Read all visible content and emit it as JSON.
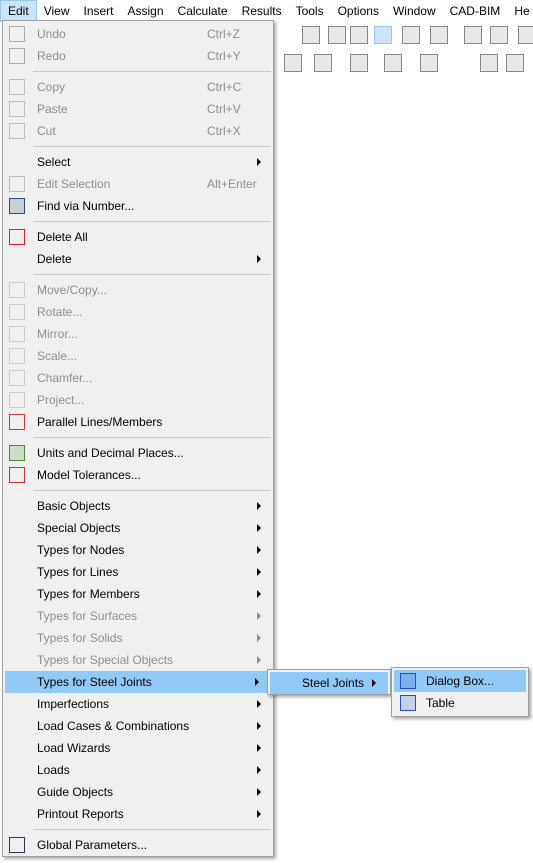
{
  "menubar": [
    "Edit",
    "View",
    "Insert",
    "Assign",
    "Calculate",
    "Results",
    "Tools",
    "Options",
    "Window",
    "CAD-BIM",
    "He"
  ],
  "edit_menu": [
    {
      "label": "Undo",
      "shortcut": "Ctrl+Z",
      "disabled": true,
      "icon": "undo-icon"
    },
    {
      "label": "Redo",
      "shortcut": "Ctrl+Y",
      "disabled": true,
      "icon": "redo-icon"
    },
    {
      "sep": true
    },
    {
      "label": "Copy",
      "shortcut": "Ctrl+C",
      "disabled": true,
      "icon": "copy-icon"
    },
    {
      "label": "Paste",
      "shortcut": "Ctrl+V",
      "disabled": true,
      "icon": "paste-icon"
    },
    {
      "label": "Cut",
      "shortcut": "Ctrl+X",
      "disabled": true,
      "icon": "cut-icon"
    },
    {
      "sep": true
    },
    {
      "label": "Select",
      "submenu": true
    },
    {
      "label": "Edit Selection",
      "shortcut": "Alt+Enter",
      "disabled": true,
      "icon": "edit-selection-icon"
    },
    {
      "label": "Find via Number...",
      "icon": "binoculars-icon"
    },
    {
      "sep": true
    },
    {
      "label": "Delete All",
      "icon": "delete-all-icon"
    },
    {
      "label": "Delete",
      "submenu": true
    },
    {
      "sep": true
    },
    {
      "label": "Move/Copy...",
      "disabled": true,
      "icon": "move-copy-icon"
    },
    {
      "label": "Rotate...",
      "disabled": true,
      "icon": "rotate-icon"
    },
    {
      "label": "Mirror...",
      "disabled": true,
      "icon": "mirror-icon"
    },
    {
      "label": "Scale...",
      "disabled": true,
      "icon": "scale-icon"
    },
    {
      "label": "Chamfer...",
      "disabled": true,
      "icon": "chamfer-icon"
    },
    {
      "label": "Project...",
      "disabled": true,
      "icon": "project-icon"
    },
    {
      "label": "Parallel Lines/Members",
      "icon": "parallel-lines-icon"
    },
    {
      "sep": true
    },
    {
      "label": "Units and Decimal Places...",
      "icon": "units-icon"
    },
    {
      "label": "Model Tolerances...",
      "icon": "tolerances-icon"
    },
    {
      "sep": true
    },
    {
      "label": "Basic Objects",
      "submenu": true
    },
    {
      "label": "Special Objects",
      "submenu": true
    },
    {
      "label": "Types for Nodes",
      "submenu": true
    },
    {
      "label": "Types for Lines",
      "submenu": true
    },
    {
      "label": "Types for Members",
      "submenu": true
    },
    {
      "label": "Types for Surfaces",
      "submenu": true,
      "disabled": true
    },
    {
      "label": "Types for Solids",
      "submenu": true,
      "disabled": true
    },
    {
      "label": "Types for Special Objects",
      "submenu": true,
      "disabled": true
    },
    {
      "label": "Types for Steel Joints",
      "submenu": true,
      "highlighted": true
    },
    {
      "label": "Imperfections",
      "submenu": true
    },
    {
      "label": "Load Cases & Combinations",
      "submenu": true
    },
    {
      "label": "Load Wizards",
      "submenu": true
    },
    {
      "label": "Loads",
      "submenu": true
    },
    {
      "label": "Guide Objects",
      "submenu": true
    },
    {
      "label": "Printout Reports",
      "submenu": true
    },
    {
      "sep": true
    },
    {
      "label": "Global Parameters...",
      "icon": "global-parameters-icon"
    }
  ],
  "submenu1": {
    "label": "Steel Joints"
  },
  "submenu2": [
    {
      "label": "Dialog Box...",
      "highlighted": true,
      "icon": "dialog-box-icon"
    },
    {
      "label": "Table",
      "icon": "table-icon"
    }
  ],
  "colors": {
    "highlight": "#91c9f7",
    "menubar_active": "#cce4f7",
    "menu_bg": "#f0f0f0",
    "disabled_text": "#8d8d8d"
  }
}
